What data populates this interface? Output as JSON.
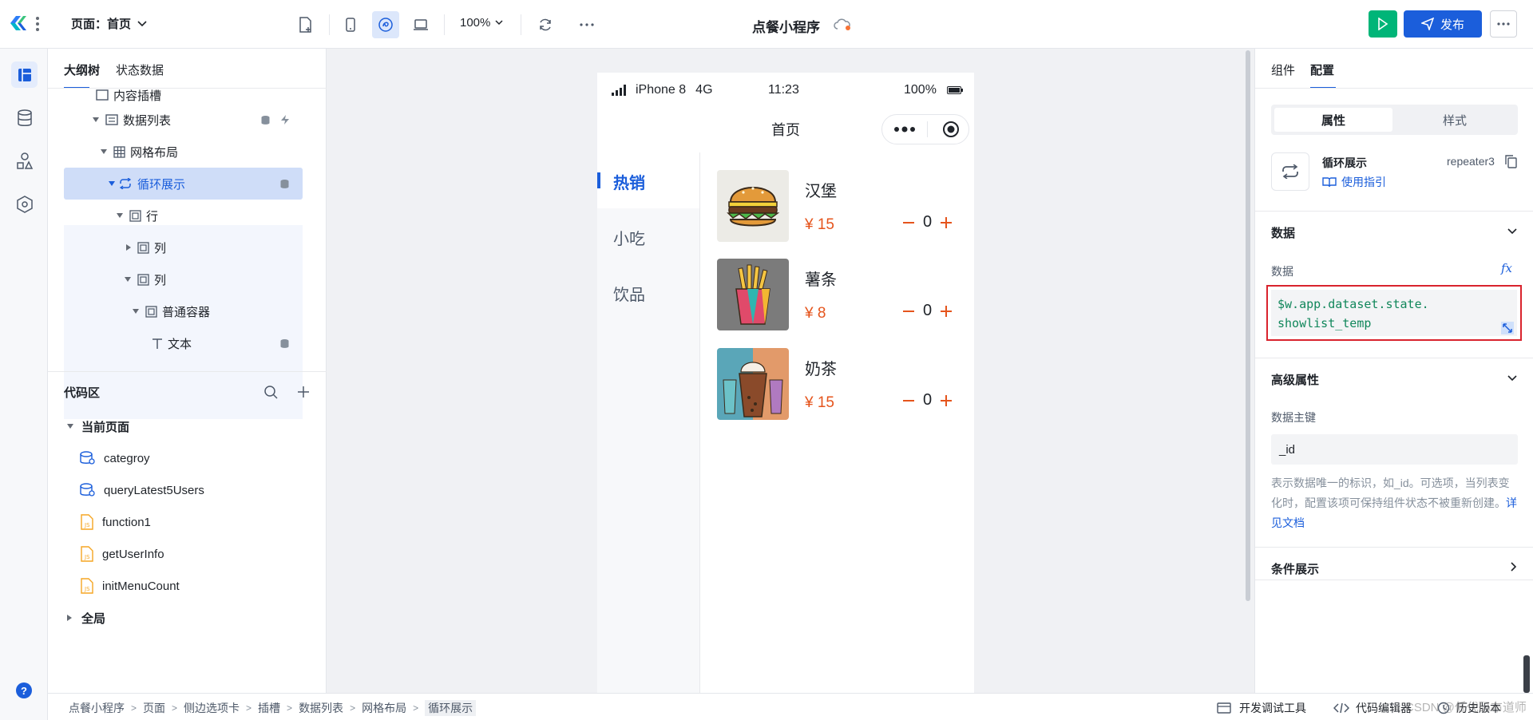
{
  "topbar": {
    "page_selector": "页面：首页",
    "zoom": "100%",
    "app_title": "点餐小程序",
    "publish_label": "发布"
  },
  "left_panel": {
    "tabs": [
      "大纲树",
      "状态数据"
    ],
    "tree_partial": "内容插槽",
    "tree": [
      {
        "label": "数据列表"
      },
      {
        "label": "网格布局"
      },
      {
        "label": "循环展示"
      },
      {
        "label": "行"
      },
      {
        "label": "列"
      },
      {
        "label": "列"
      },
      {
        "label": "普通容器"
      },
      {
        "label": "文本"
      }
    ],
    "code_area": {
      "title": "代码区",
      "current_page": "当前页面",
      "items": [
        "categroy",
        "queryLatest5Users",
        "function1",
        "getUserInfo",
        "initMenuCount"
      ],
      "global": "全局"
    }
  },
  "phone": {
    "status": {
      "device": "iPhone 8",
      "network": "4G",
      "time": "11:23",
      "battery": "100%"
    },
    "nav_title": "首页",
    "categories": [
      "热销",
      "小吃",
      "饮品"
    ],
    "products": [
      {
        "name": "汉堡",
        "price": "¥ 15",
        "count": "0"
      },
      {
        "name": "薯条",
        "price": "¥ 8",
        "count": "0"
      },
      {
        "name": "奶茶",
        "price": "¥ 15",
        "count": "0"
      }
    ]
  },
  "right_panel": {
    "tabs": [
      "组件",
      "配置"
    ],
    "subtabs": [
      "属性",
      "样式"
    ],
    "component_name": "循环展示",
    "component_id": "repeater3",
    "guide_link": "使用指引",
    "data_section": "数据",
    "data_label": "数据",
    "fx_label": "fx",
    "data_expr_line1": "$w.app.dataset.state.",
    "data_expr_line2": "showlist_temp",
    "advanced_section": "高级属性",
    "key_label": "数据主键",
    "key_value": "_id",
    "key_help": "表示数据唯一的标识，如_id。可选项，当列表变化时，配置该项可保持组件状态不被重新创建。",
    "doc_link": "详见文档",
    "condition_section": "条件展示"
  },
  "bottom": {
    "breadcrumb": [
      "点餐小程序",
      "页面",
      "侧边选项卡",
      "插槽",
      "数据列表",
      "网格布局",
      "循环展示"
    ],
    "dev_tools": "开发调试工具",
    "code_editor": "代码编辑器",
    "history": "历史版本",
    "watermark": "CSDN @低代码布道师"
  },
  "colors": {
    "primary": "#1b5edb",
    "green": "#00b578",
    "price": "#e5541c",
    "code": "#11875b"
  }
}
